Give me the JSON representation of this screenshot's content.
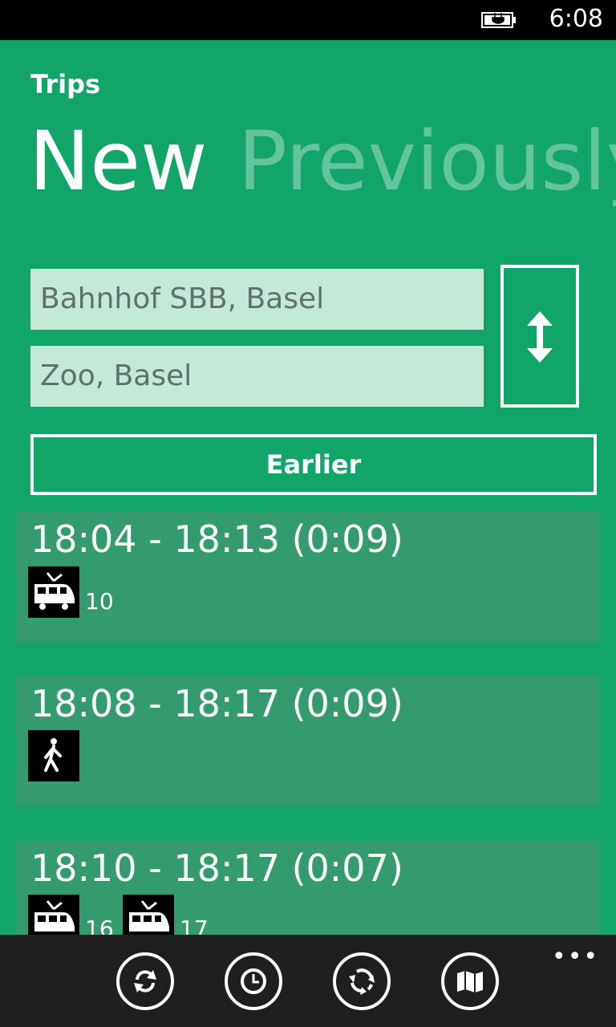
{
  "status_bar": {
    "time": "6:08",
    "battery_icon": "battery-charging-icon"
  },
  "app_title": "Trips",
  "pivot": {
    "active": "New",
    "inactive": "Previously"
  },
  "from_input": {
    "value": "Bahnhof SBB, Basel"
  },
  "to_input": {
    "value": "Zoo, Basel"
  },
  "swap_button": {
    "icon": "swap-vertical-icon"
  },
  "earlier_button": {
    "label": "Earlier"
  },
  "trips": [
    {
      "times": "18:04 - 18:13 (0:09)",
      "legs": [
        {
          "icon": "tram-icon",
          "line": "10"
        }
      ]
    },
    {
      "times": "18:08 - 18:17 (0:09)",
      "legs": [
        {
          "icon": "walk-icon",
          "line": ""
        }
      ]
    },
    {
      "times": "18:10 - 18:17 (0:07)",
      "legs": [
        {
          "icon": "tram-icon",
          "line": "16"
        },
        {
          "icon": "tram-icon",
          "line": "17"
        }
      ]
    }
  ],
  "app_bar": {
    "buttons": [
      "refresh-icon",
      "clock-icon",
      "sync-icon",
      "map-icon"
    ],
    "more": "•••"
  },
  "colors": {
    "background": "#12a56a",
    "card": "#349b6e",
    "input": "#c4e9d8",
    "appbar": "#1f1f1f"
  }
}
